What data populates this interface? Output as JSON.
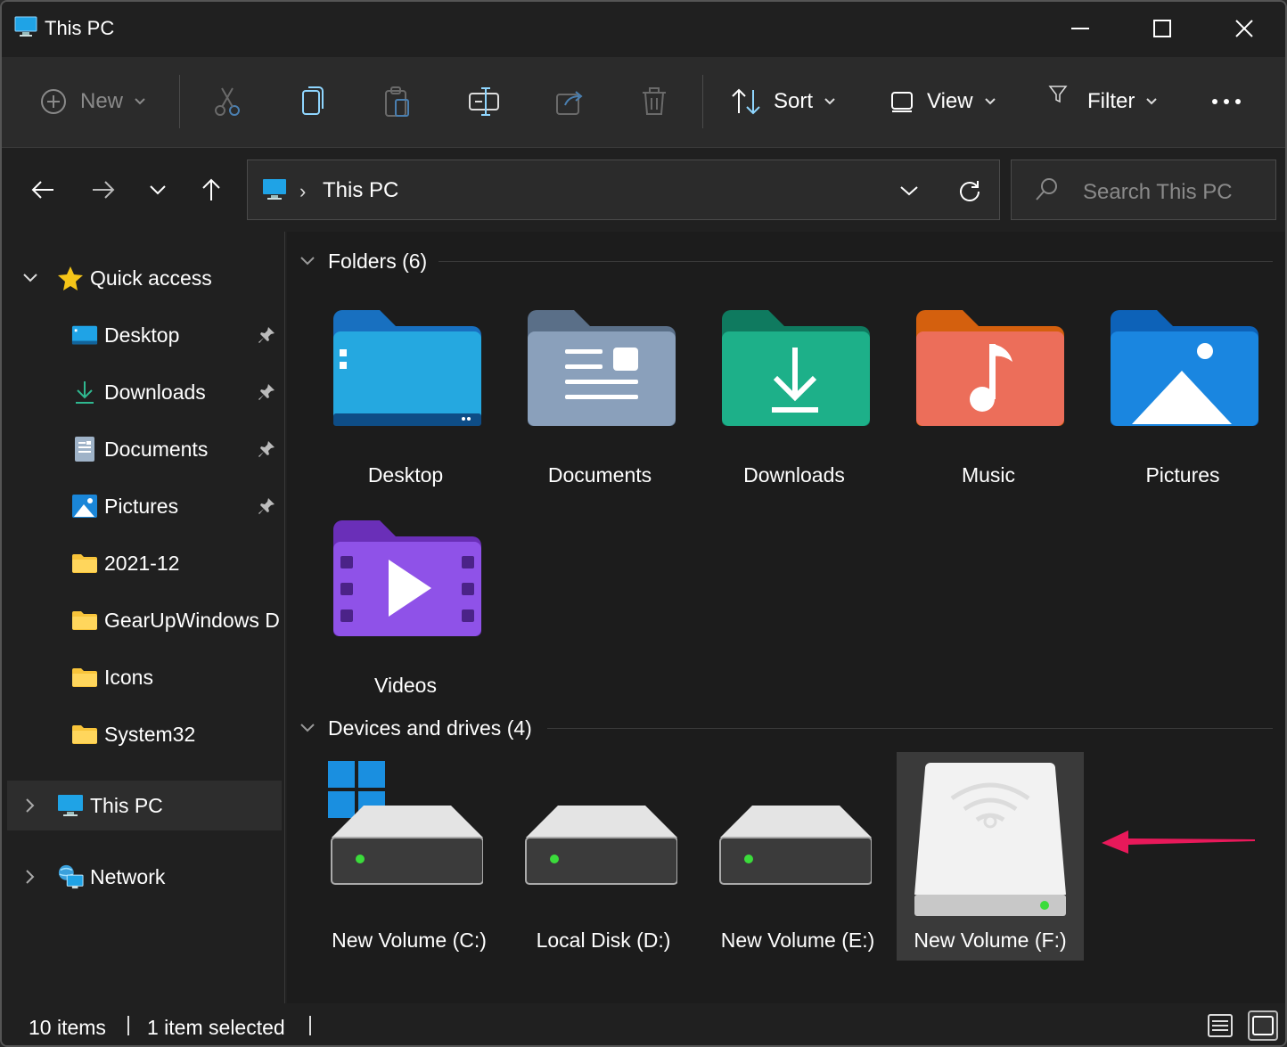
{
  "window": {
    "title": "This PC"
  },
  "commandbar": {
    "new_label": "New",
    "sort_label": "Sort",
    "view_label": "View",
    "filter_label": "Filter",
    "more_label": "•••"
  },
  "navigation": {
    "breadcrumb_location": "This PC",
    "search_placeholder": "Search This PC"
  },
  "sidebar": {
    "quick_access": "Quick access",
    "items": [
      {
        "label": "Desktop",
        "pinned": true,
        "icon": "desktop-icon"
      },
      {
        "label": "Downloads",
        "pinned": true,
        "icon": "downloads-icon"
      },
      {
        "label": "Documents",
        "pinned": true,
        "icon": "documents-icon"
      },
      {
        "label": "Pictures",
        "pinned": true,
        "icon": "pictures-icon"
      },
      {
        "label": "2021-12",
        "pinned": false,
        "icon": "folder-icon"
      },
      {
        "label": "GearUpWindows D",
        "pinned": false,
        "icon": "folder-icon"
      },
      {
        "label": "Icons",
        "pinned": false,
        "icon": "folder-icon"
      },
      {
        "label": "System32",
        "pinned": false,
        "icon": "folder-icon"
      }
    ],
    "this_pc": "This PC",
    "network": "Network"
  },
  "main": {
    "folders_header": "Folders (6)",
    "folders": [
      {
        "label": "Desktop",
        "color": "#1e9ed8"
      },
      {
        "label": "Documents",
        "color": "#7b93ae"
      },
      {
        "label": "Downloads",
        "color": "#1aa58a"
      },
      {
        "label": "Music",
        "color": "#e8664b"
      },
      {
        "label": "Pictures",
        "color": "#1a86d8"
      },
      {
        "label": "Videos",
        "color": "#8a4fe0"
      }
    ],
    "drives_header": "Devices and drives (4)",
    "drives": [
      {
        "label": "New Volume (C:)",
        "system": true
      },
      {
        "label": "Local Disk (D:)",
        "system": false
      },
      {
        "label": "New Volume (E:)",
        "system": false
      },
      {
        "label": "New Volume (F:)",
        "selected": true
      }
    ]
  },
  "statusbar": {
    "items_count": "10 items",
    "selection": "1 item selected"
  },
  "colors": {
    "accent_arrow": "#e8195a",
    "background": "#1c1c1c"
  }
}
